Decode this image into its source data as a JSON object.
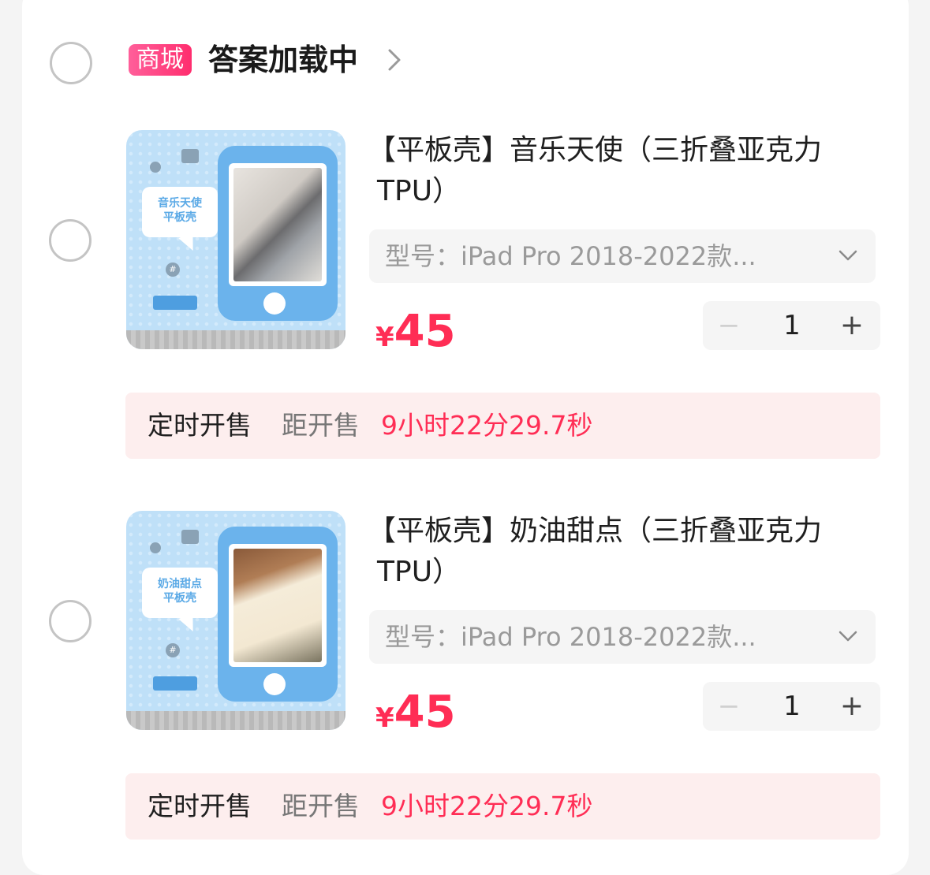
{
  "shop": {
    "badge": "商城",
    "name": "答案加载中"
  },
  "items": [
    {
      "thumb_caption_line1": "音乐天使",
      "thumb_caption_line2": "平板壳",
      "title_line1": "【平板壳】音乐天使（三折叠亚克力",
      "title_line2": "TPU）",
      "variant": "型号：iPad Pro 2018-2022款...",
      "currency": "¥",
      "price": "45",
      "minus": "−",
      "quantity": "1",
      "plus": "+",
      "sale_label": "定时开售",
      "sale_dist": "距开售",
      "sale_countdown": "9小时22分29.7秒"
    },
    {
      "thumb_caption_line1": "奶油甜点",
      "thumb_caption_line2": "平板壳",
      "title_line1": "【平板壳】奶油甜点（三折叠亚克力",
      "title_line2": "TPU）",
      "variant": "型号：iPad Pro 2018-2022款...",
      "currency": "¥",
      "price": "45",
      "minus": "−",
      "quantity": "1",
      "plus": "+",
      "sale_label": "定时开售",
      "sale_dist": "距开售",
      "sale_countdown": "9小时22分29.7秒"
    }
  ],
  "colors": {
    "accent": "#ff2d55",
    "badge": "#ff4f86",
    "sale_bg": "#fdeeee"
  }
}
